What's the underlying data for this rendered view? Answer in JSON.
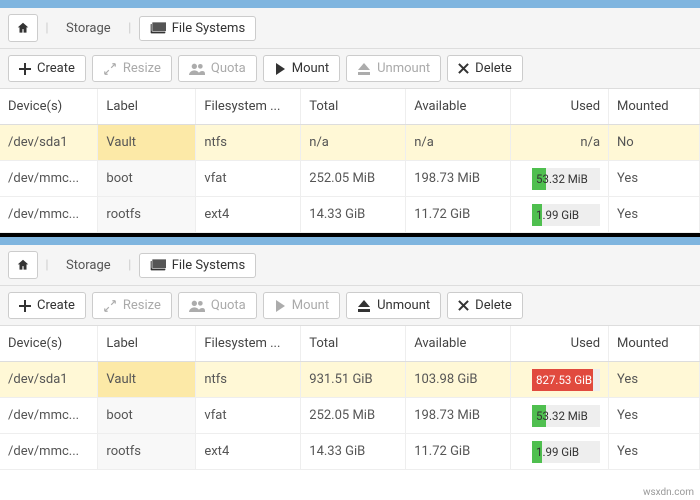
{
  "breadcrumb": {
    "storage": "Storage",
    "filesystems": "File Systems"
  },
  "toolbar": {
    "create": "Create",
    "resize": "Resize",
    "quota": "Quota",
    "mount": "Mount",
    "unmount": "Unmount",
    "delete": "Delete"
  },
  "headers": {
    "devices": "Device(s)",
    "label": "Label",
    "fs": "Filesystem ...",
    "total": "Total",
    "available": "Available",
    "used": "Used",
    "mounted": "Mounted"
  },
  "top": {
    "rows": [
      {
        "device": "/dev/sda1",
        "label": "Vault",
        "fs": "ntfs",
        "total": "n/a",
        "available": "n/a",
        "used_text": "n/a",
        "used_pct": null,
        "mounted": "No",
        "selected": true
      },
      {
        "device": "/dev/mmc...",
        "label": "boot",
        "fs": "vfat",
        "total": "252.05 MiB",
        "available": "198.73 MiB",
        "used_text": "53.32 MiB",
        "used_pct": 21,
        "used_red": false,
        "mounted": "Yes",
        "selected": false
      },
      {
        "device": "/dev/mmc...",
        "label": "rootfs",
        "fs": "ext4",
        "total": "14.33 GiB",
        "available": "11.72 GiB",
        "used_text": "1.99 GiB",
        "used_pct": 14,
        "used_red": false,
        "mounted": "Yes",
        "selected": false
      }
    ]
  },
  "bottom": {
    "rows": [
      {
        "device": "/dev/sda1",
        "label": "Vault",
        "fs": "ntfs",
        "total": "931.51 GiB",
        "available": "103.98 GiB",
        "used_text": "827.53 GiB",
        "used_pct": 89,
        "used_red": true,
        "mounted": "Yes",
        "selected": true
      },
      {
        "device": "/dev/mmc...",
        "label": "boot",
        "fs": "vfat",
        "total": "252.05 MiB",
        "available": "198.73 MiB",
        "used_text": "53.32 MiB",
        "used_pct": 21,
        "used_red": false,
        "mounted": "Yes",
        "selected": false
      },
      {
        "device": "/dev/mmc...",
        "label": "rootfs",
        "fs": "ext4",
        "total": "14.33 GiB",
        "available": "11.72 GiB",
        "used_text": "1.99 GiB",
        "used_pct": 14,
        "used_red": false,
        "mounted": "Yes",
        "selected": false
      }
    ]
  },
  "watermark": "wsxdn.com"
}
